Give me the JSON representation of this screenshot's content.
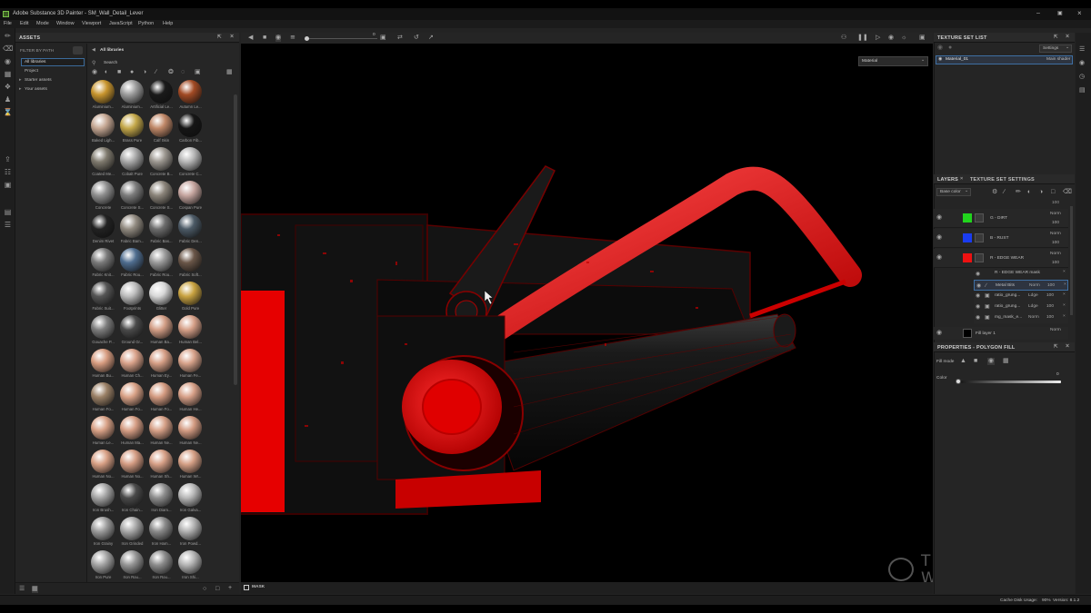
{
  "window": {
    "title": "Adobe Substance 3D Painter - SM_Wall_Detail_Lever"
  },
  "menu": [
    "File",
    "Edit",
    "Mode",
    "Window",
    "Viewport",
    "JavaScript",
    "Python",
    "Help"
  ],
  "assets": {
    "title": "ASSETS",
    "filter_label": "FILTER BY PATH",
    "tree": [
      "All libraries",
      "Project",
      "Starter assets",
      "Your assets"
    ],
    "breadcrumb": "All libraries",
    "search_placeholder": "Search",
    "items": [
      {
        "label": "Aluminium...",
        "color": "#c8952e"
      },
      {
        "label": "Aluminium...",
        "color": "#9c9c9c"
      },
      {
        "label": "Artificial Le...",
        "color": "#1a1a1a"
      },
      {
        "label": "Autumn Le...",
        "color": "#a24a24"
      },
      {
        "label": "Baked Ligh...",
        "color": "#c5a793"
      },
      {
        "label": "Brass Pure",
        "color": "#c4a84a"
      },
      {
        "label": "Calf Skin",
        "color": "#c08868"
      },
      {
        "label": "Carbon Fib...",
        "color": "#161616"
      },
      {
        "label": "Coated Me...",
        "color": "#7f7a6e"
      },
      {
        "label": "Cobalt Pure",
        "color": "#a8a8a8"
      },
      {
        "label": "Concrete B...",
        "color": "#9b968f"
      },
      {
        "label": "Concrete C...",
        "color": "#b7b7b7"
      },
      {
        "label": "Concrete",
        "color": "#8f8f8f"
      },
      {
        "label": "Concrete S...",
        "color": "#7c7c7c"
      },
      {
        "label": "Concrete S...",
        "color": "#8b847a"
      },
      {
        "label": "Cospan Pure",
        "color": "#c6a6a0"
      },
      {
        "label": "Denim Rivet",
        "color": "#222222"
      },
      {
        "label": "Fabric Bam...",
        "color": "#918a80"
      },
      {
        "label": "Fabric Bas...",
        "color": "#6d6d6d"
      },
      {
        "label": "Fabric Den...",
        "color": "#4c5a66"
      },
      {
        "label": "Fabric Knit...",
        "color": "#7a7a7a"
      },
      {
        "label": "Fabric Rou...",
        "color": "#4f6d8f"
      },
      {
        "label": "Fabric Rou...",
        "color": "#9a9a9a"
      },
      {
        "label": "Fabric Soft...",
        "color": "#6a5648"
      },
      {
        "label": "Fabric Suit...",
        "color": "#555555"
      },
      {
        "label": "Footprints",
        "color": "#bdbdbd"
      },
      {
        "label": "Glitter",
        "color": "#d8d8d8"
      },
      {
        "label": "Gold Pure",
        "color": "#c9a341"
      },
      {
        "label": "Gouache P...",
        "color": "#7d7d7d"
      },
      {
        "label": "Ground Gr...",
        "color": "#4a4a4a"
      },
      {
        "label": "Human Ba...",
        "color": "#d39e86"
      },
      {
        "label": "Human Bel...",
        "color": "#d6a088"
      },
      {
        "label": "Human Bu...",
        "color": "#d79c80"
      },
      {
        "label": "Human Ch...",
        "color": "#d9a28a"
      },
      {
        "label": "Human Ey...",
        "color": "#d59e85"
      },
      {
        "label": "Human Fe...",
        "color": "#d8a38b"
      },
      {
        "label": "Human Fo...",
        "color": "#9a8066"
      },
      {
        "label": "Human Fo...",
        "color": "#d9a287"
      },
      {
        "label": "Human Fo...",
        "color": "#d49b81"
      },
      {
        "label": "Human He...",
        "color": "#d7a088"
      },
      {
        "label": "Human Le...",
        "color": "#d8a186"
      },
      {
        "label": "Human Ma...",
        "color": "#d59d84"
      },
      {
        "label": "Human Ne...",
        "color": "#d6a087"
      },
      {
        "label": "Human Ne...",
        "color": "#d39b82"
      },
      {
        "label": "Human No...",
        "color": "#d8a085"
      },
      {
        "label": "Human No...",
        "color": "#d49c83"
      },
      {
        "label": "Human Sh...",
        "color": "#d7a087"
      },
      {
        "label": "Human Wr...",
        "color": "#d5a086"
      },
      {
        "label": "Iron Brush...",
        "color": "#a6a6a6"
      },
      {
        "label": "Iron Chain...",
        "color": "#4a4a4a"
      },
      {
        "label": "Iron Diam...",
        "color": "#8e8e8e"
      },
      {
        "label": "Iron Galva...",
        "color": "#b8b8b8"
      },
      {
        "label": "Iron Grainy",
        "color": "#9c9c9c"
      },
      {
        "label": "Iron Grinded",
        "color": "#a9a9a9"
      },
      {
        "label": "Iron Ham...",
        "color": "#8a8a8a"
      },
      {
        "label": "Iron Powd...",
        "color": "#b2b2b2"
      },
      {
        "label": "Iron Pure",
        "color": "#a4a4a4"
      },
      {
        "label": "Iron Rou...",
        "color": "#959595"
      },
      {
        "label": "Iron Rou...",
        "color": "#8c8c8c"
      },
      {
        "label": "Iron Shi...",
        "color": "#b4b4b4"
      }
    ]
  },
  "viewport": {
    "mode_select": "Material",
    "slider_value": "0",
    "mask_label": "MASK"
  },
  "texture_set_list": {
    "title": "TEXTURE SET LIST",
    "settings_label": "Settings",
    "material": "Material_01",
    "shader": "Main shader"
  },
  "layers": {
    "tab_layers": "LAYERS",
    "tab_tss": "TEXTURE SET SETTINGS",
    "channel": "Base color",
    "rows": [
      {
        "name": "G - DIRT",
        "blend": "Norm",
        "opacity": "100",
        "color": "#21d41d"
      },
      {
        "name": "B - RUST",
        "blend": "Norm",
        "opacity": "100",
        "color": "#1a3cf0"
      },
      {
        "name": "R - EDGE WEAR",
        "blend": "Norm",
        "opacity": "100",
        "color": "#ee1111"
      }
    ],
    "mask_title": "R - EDGE WEAR mask",
    "effects": [
      {
        "name": "Metal Bits",
        "blend": "Norm",
        "opacity": "100"
      },
      {
        "name": "ratio_grung...",
        "blend": "Ldge",
        "opacity": "100"
      },
      {
        "name": "ratio_grung...",
        "blend": "Ldge",
        "opacity": "100"
      },
      {
        "name": "mg_mask_e...",
        "blend": "Norm",
        "opacity": "100"
      }
    ],
    "fill_layer": {
      "name": "Fill layer 1",
      "blend": "Norm"
    }
  },
  "properties": {
    "title": "PROPERTIES - POLYGON FILL",
    "fill_mode_label": "Fill mode",
    "color_label": "Color",
    "color_value": "0"
  },
  "status": {
    "cache": "Cache Disk Usage:",
    "cache_value": "90%",
    "version": "Version: 8.1.2"
  },
  "watermark": {
    "line1": "THE GNOMON",
    "line2": "WORKSHOP"
  }
}
